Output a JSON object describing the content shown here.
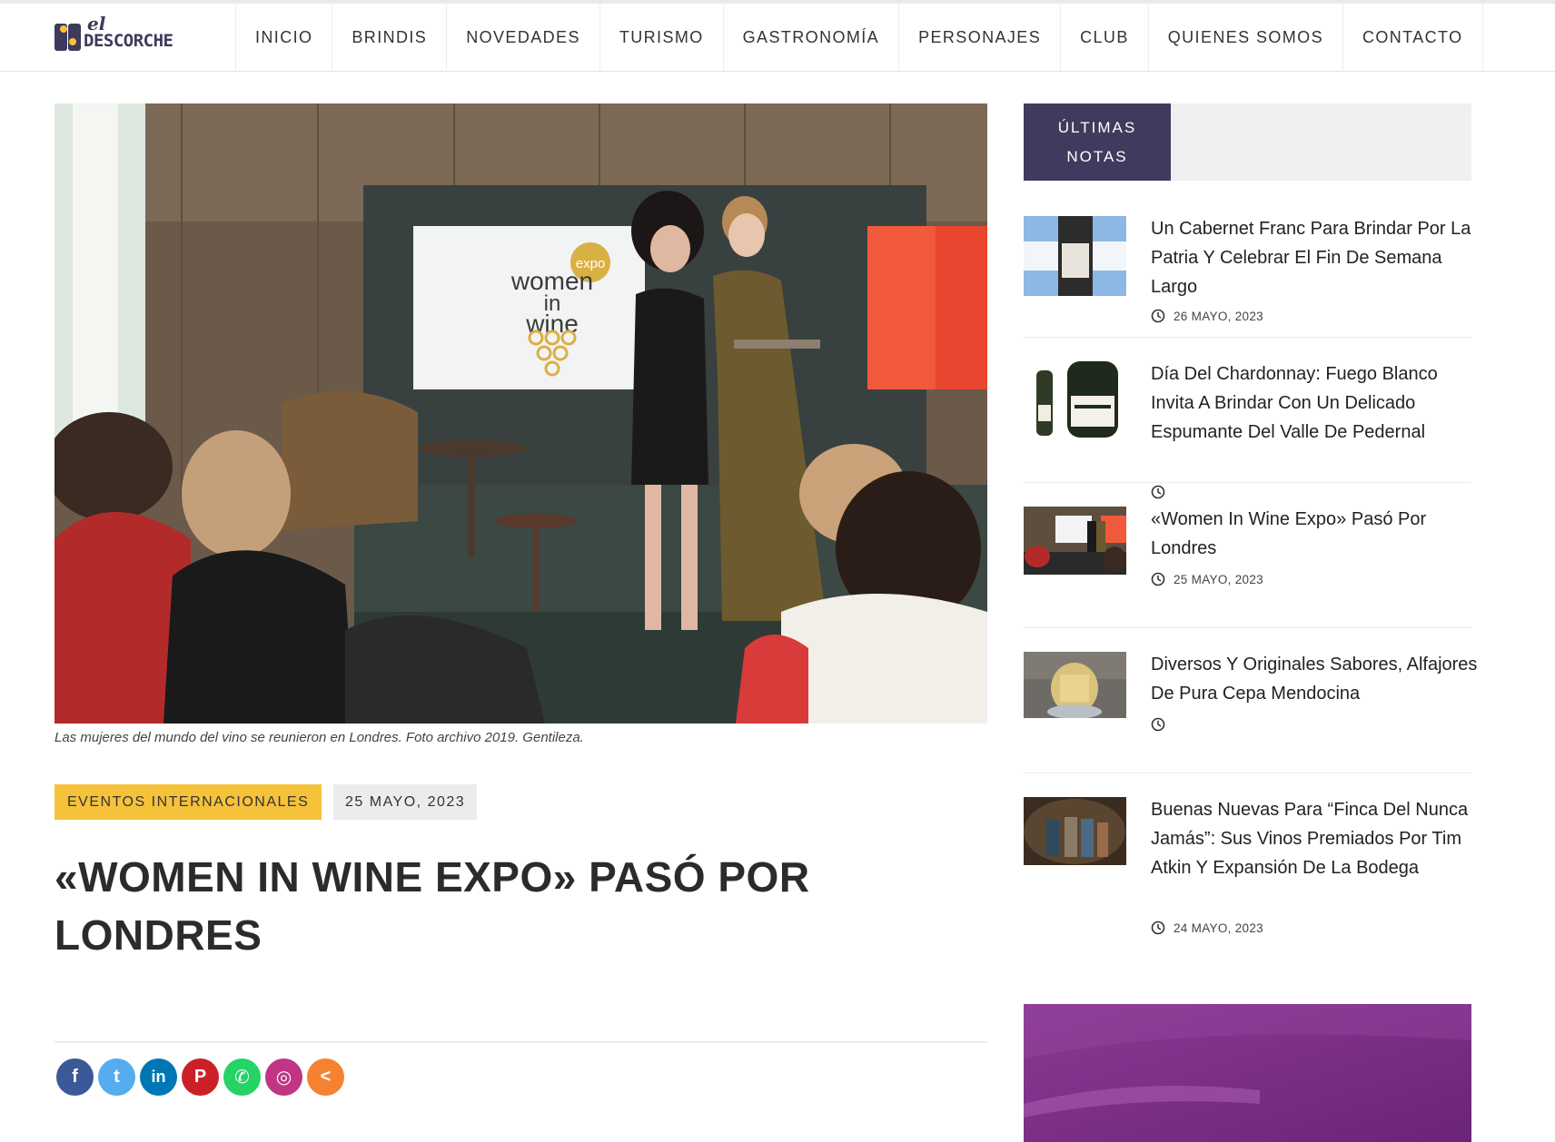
{
  "site": {
    "logo_small": "el",
    "logo_main": "DESCORCHE",
    "nav": [
      "INICIO",
      "BRINDIS",
      "NOVEDADES",
      "TURISMO",
      "GASTRONOMÍA",
      "PERSONAJES",
      "CLUB",
      "QUIENES SOMOS",
      "CONTACTO"
    ]
  },
  "article": {
    "hero_alt": "Las mujeres del mundo del vino se reunieron en Londres. Foto archivo 2019. Gentileza.",
    "screen_expo": "expo",
    "screen_line1": "women",
    "screen_line2": "in",
    "screen_line3": "wine",
    "caption": "Las mujeres del mundo del vino se reunieron en Londres. Foto archivo 2019. Gentileza.",
    "category": "EVENTOS INTERNACIONALES",
    "date": "25 MAYO, 2023",
    "title": "«WOMEN IN WINE EXPO» PASÓ POR LONDRES",
    "share": [
      {
        "name": "facebook-icon",
        "glyph": "f",
        "color": "#3b5998"
      },
      {
        "name": "twitter-icon",
        "glyph": "t",
        "color": "#55acee"
      },
      {
        "name": "linkedin-icon",
        "glyph": "in",
        "color": "#0077b5"
      },
      {
        "name": "pinterest-icon",
        "glyph": "P",
        "color": "#cb2027"
      },
      {
        "name": "whatsapp-icon",
        "glyph": "✆",
        "color": "#25d366"
      },
      {
        "name": "instagram-icon",
        "glyph": "◎",
        "color": "#c13584"
      },
      {
        "name": "more-share-icon",
        "glyph": "<",
        "color": "#f58230"
      }
    ]
  },
  "sidebar": {
    "tab_label_1": "ÚLTIMAS",
    "tab_label_2": "NOTAS",
    "notes": [
      {
        "title": "Un Cabernet Franc Para Brindar Por La Patria Y Celebrar El Fin De Semana Largo",
        "date": "26 MAYO, 2023"
      },
      {
        "title": "Día Del Chardonnay: Fuego Blanco Invita A Brindar Con Un Delicado Espumante Del Valle De Pedernal",
        "date": ""
      },
      {
        "title": "«Women In Wine Expo» Pasó Por Londres",
        "date": "25 MAYO, 2023"
      },
      {
        "title": "Diversos Y Originales Sabores, Alfajores De Pura Cepa Mendocina",
        "date": ""
      },
      {
        "title": "Buenas Nuevas Para “Finca Del Nunca Jamás”: Sus Vinos Premiados Por Tim Atkin Y Expansión De La Bodega",
        "date": "24 MAYO, 2023"
      }
    ]
  },
  "colors": {
    "accent_purple": "#423a5e",
    "category_yellow": "#f6c23a",
    "ad_purple": "#7a2f86"
  }
}
